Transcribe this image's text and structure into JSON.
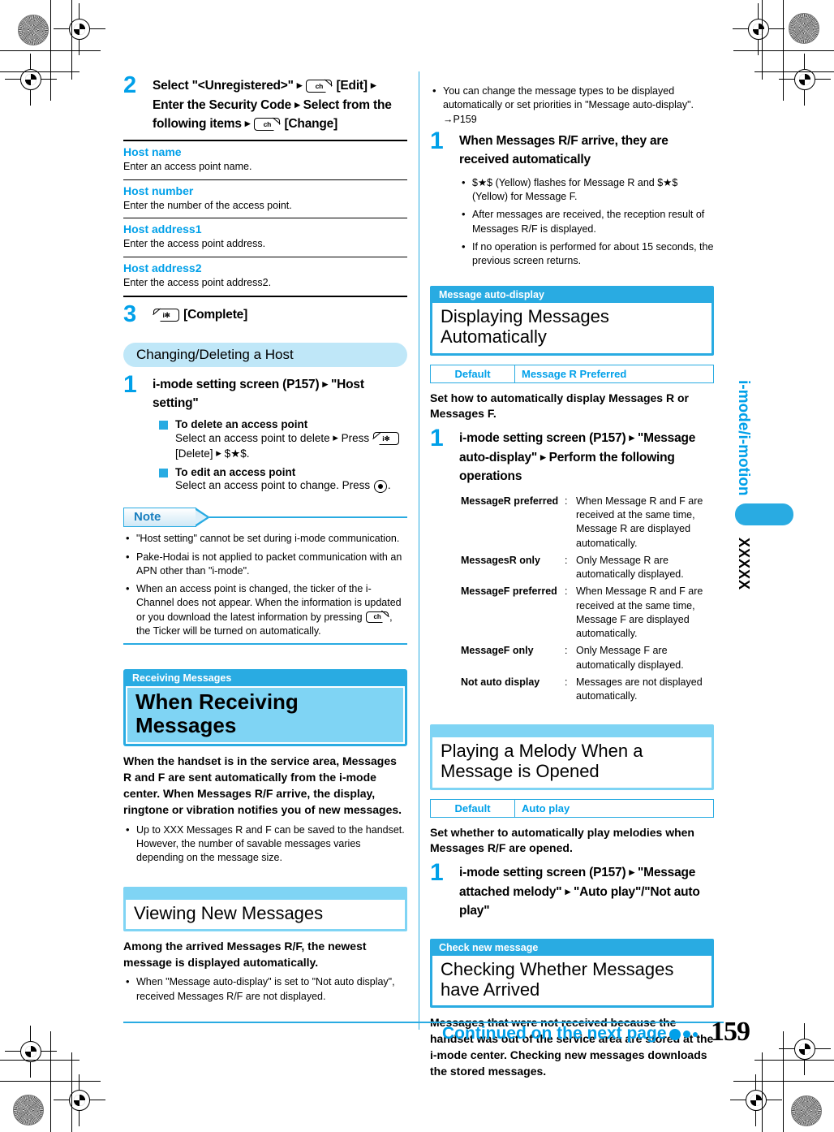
{
  "page": {
    "number": "159",
    "side_tab": "i-mode/i-motion",
    "side_tab_code": "XXXXX",
    "continued": "Continued on the next page",
    "accent_blue": "#00A0E9",
    "band_blue": "#29ABE2",
    "light_blue": "#7FD4F4",
    "pale_blue": "#BFE7F8"
  },
  "left": {
    "step2": {
      "num": "2",
      "part1": "Select \"<Unregistered>\"",
      "key1": "ch",
      "label1": "[Edit]",
      "part2": "Enter the Security Code",
      "part3": "Select from the following items",
      "key2": "ch",
      "label2": "[Change]"
    },
    "items": [
      {
        "title": "Host name",
        "desc": "Enter an access point name."
      },
      {
        "title": "Host number",
        "desc": "Enter the number of the access point."
      },
      {
        "title": "Host address1",
        "desc": "Enter the access point address."
      },
      {
        "title": "Host address2",
        "desc": "Enter the access point address2."
      }
    ],
    "step3": {
      "num": "3",
      "key": "i✻",
      "label": "[Complete]"
    },
    "band": "Changing/Deleting a Host",
    "step1": {
      "num": "1",
      "text_a": "i-mode setting screen (P157)",
      "text_b": "\"Host setting\""
    },
    "sub_items": [
      {
        "head": "To delete an access point",
        "body_a": "Select an access point to delete",
        "body_key": "i✻",
        "body_b": "[Delete]",
        "body_c": "$★$."
      },
      {
        "head": "To edit an access point",
        "body_a": "Select an access point to change. Press",
        "body_b": "."
      }
    ],
    "note": {
      "label": "Note",
      "bullets": [
        "\"Host setting\" cannot be set during i-mode communication.",
        "Pake-Hodai is not applied to packet communication with an APN other than \"i-mode\".",
        "When an access point is changed, the ticker of the i-Channel does not appear. When the information is updated or you download the latest information by pressing"
      ],
      "bullet3_tail": ", the Ticker will be turned on automatically."
    },
    "section_receiving": {
      "tag": "Receiving Messages",
      "title": "When Receiving Messages",
      "lead": "When the handset is in the service area, Messages R and F are sent automatically from the i-mode center. When Messages R/F arrive, the display, ringtone or vibration notifies you of new messages.",
      "bullets": [
        "Up to XXX Messages R and F can be saved to the handset. However, the number of savable messages varies depending on the message size."
      ]
    },
    "section_viewing": {
      "title": "Viewing New Messages",
      "lead": "Among the arrived Messages R/F, the newest message is displayed automatically.",
      "bullets": [
        "When \"Message auto-display\" is set to \"Not auto display\", received Messages R/F are not displayed."
      ]
    }
  },
  "right": {
    "top_bullets": [
      "You can change the message types to be displayed automatically or set priorities in \"Message auto-display\". →P159"
    ],
    "step1": {
      "num": "1",
      "text": "When Messages R/F arrive, they are received automatically",
      "bullets": [
        "$★$ (Yellow) flashes for Message R and $★$ (Yellow) for Message F.",
        "After messages are received, the reception result of Messages R/F is displayed.",
        "If no operation is performed for about 15 seconds, the previous screen returns."
      ]
    },
    "section_autodisplay": {
      "tag": "Message auto-display",
      "title": "Displaying Messages Automatically",
      "default_label": "Default",
      "default_value": "Message R Preferred",
      "lead": "Set how to automatically display Messages R or Messages F.",
      "step": {
        "num": "1",
        "text_a": "i-mode setting screen (P157)",
        "text_b": "\"Message auto-display\"",
        "text_c": "Perform the following operations"
      },
      "options": [
        {
          "name": "MessageR preferred",
          "colon": ":",
          "value": "When Message R and F are received at the same time, Message R are displayed automatically."
        },
        {
          "name": "MessagesR only",
          "colon": ":",
          "value": "Only Message R are automatically displayed."
        },
        {
          "name": "MessageF preferred",
          "colon": ":",
          "value": "When Message R and F are received at the same time, Message F are displayed automatically."
        },
        {
          "name": "MessageF only",
          "colon": ":",
          "value": "Only Message F are automatically displayed."
        },
        {
          "name": "Not auto display",
          "colon": ":",
          "value": "Messages are not displayed automatically."
        }
      ]
    },
    "section_melody": {
      "title": "Playing a Melody When a Message is Opened",
      "default_label": "Default",
      "default_value": "Auto play",
      "lead": "Set whether to automatically play melodies when Messages R/F are opened.",
      "step": {
        "num": "1",
        "text_a": "i-mode setting screen (P157)",
        "text_b": "\"Message attached melody\"",
        "text_c": "\"Auto play\"/\"Not auto play\""
      }
    },
    "section_checknew": {
      "tag": "Check new message",
      "title": "Checking Whether Messages have Arrived",
      "lead": "Messages that were not received because the handset was out of the service area are stored at the i-mode center. Checking new messages downloads the stored messages."
    }
  }
}
